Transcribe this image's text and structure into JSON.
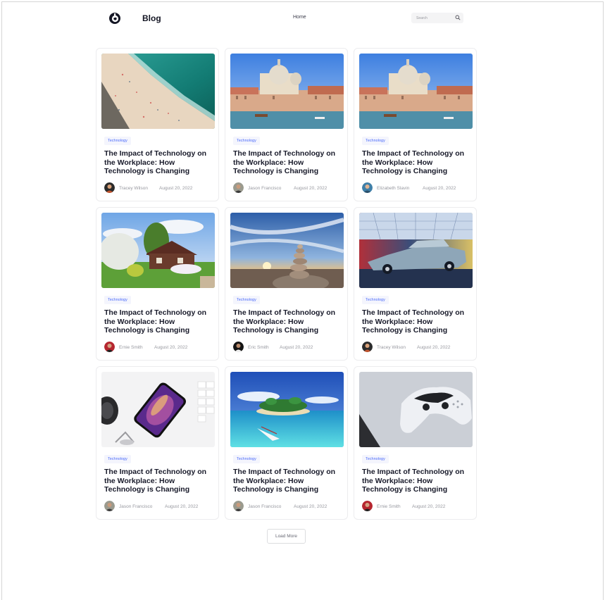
{
  "header": {
    "brand": "Blog",
    "nav_home": "Home",
    "search_placeholder": "Search"
  },
  "posts": [
    {
      "tag": "Technology",
      "title": "The Impact of Technology on the Workplace: How Technology is Changing",
      "author": "Tracey Wilson",
      "date": "August 20, 2022",
      "image": "beach-aerial-photo"
    },
    {
      "tag": "Technology",
      "title": "The Impact of Technology on the Workplace: How Technology is Changing",
      "author": "Jason Francisco",
      "date": "August 20, 2022",
      "image": "venice-canal-photo"
    },
    {
      "tag": "Technology",
      "title": "The Impact of Technology on the Workplace: How Technology is Changing",
      "author": "Elizabeth Slavin",
      "date": "August 20, 2022",
      "image": "venice-canal-photo"
    },
    {
      "tag": "Technology",
      "title": "The Impact of Technology on the Workplace: How Technology is Changing",
      "author": "Ernie Smith",
      "date": "August 20, 2022",
      "image": "cottage-garden-photo"
    },
    {
      "tag": "Technology",
      "title": "The Impact of Technology on the Workplace: How Technology is Changing",
      "author": "Eric Smith",
      "date": "August 20, 2022",
      "image": "stacked-stones-sunset-photo"
    },
    {
      "tag": "Technology",
      "title": "The Impact of Technology on the Workplace: How Technology is Changing",
      "author": "Tracey Wilson",
      "date": "August 20, 2022",
      "image": "vintage-car-photo"
    },
    {
      "tag": "Technology",
      "title": "The Impact of Technology on the Workplace: How Technology is Changing",
      "author": "Jason Francisco",
      "date": "August 20, 2022",
      "image": "smartphone-desk-photo"
    },
    {
      "tag": "Technology",
      "title": "The Impact of Technology on the Workplace: How Technology is Changing",
      "author": "Jason Francisco",
      "date": "August 20, 2022",
      "image": "tropical-island-photo"
    },
    {
      "tag": "Technology",
      "title": "The Impact of Technology on the Workplace: How Technology is Changing",
      "author": "Ernie Smith",
      "date": "August 20, 2022",
      "image": "game-controller-photo"
    }
  ],
  "load_more_label": "Load More",
  "colors": {
    "tag_text": "#4b6bfb",
    "tag_bg": "#f4f5fd",
    "title_text": "#181a2a",
    "meta_text": "#97989f"
  }
}
